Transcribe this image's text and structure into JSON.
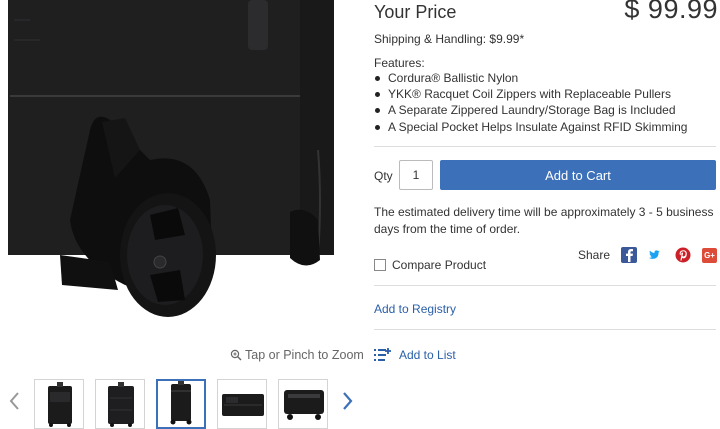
{
  "product": {
    "price_label": "Your Price",
    "price": "$ 99.99",
    "shipping": "Shipping & Handling: $9.99*",
    "features_title": "Features:",
    "features": [
      "Cordura® Ballistic Nylon",
      "YKK® Racquet Coil Zippers with Replaceable Pullers",
      "A Separate Zippered Laundry/Storage Bag is Included",
      "A Special Pocket Helps Insulate Against RFID Skimming"
    ]
  },
  "cart": {
    "qty_label": "Qty",
    "qty_value": "1",
    "add_to_cart_label": "Add to Cart"
  },
  "delivery_text": "The estimated delivery time will be approximately 3 - 5 business days from the time of order.",
  "compare_label": "Compare Product",
  "share": {
    "label": "Share",
    "networks": [
      "facebook-icon",
      "twitter-icon",
      "pinterest-icon",
      "google-plus-icon"
    ],
    "google_plus_glyph": "G+"
  },
  "registry_label": "Add to Registry",
  "list_label": "Add to List",
  "gallery": {
    "zoom_hint": "Tap or Pinch to Zoom",
    "thumbnail_count": 5,
    "active_thumbnail": 3
  },
  "colors": {
    "accent": "#3c70b8",
    "link": "#2a5fa8",
    "facebook": "#3b5998",
    "twitter": "#1da1f2",
    "pinterest": "#cb2027",
    "google_plus": "#dd4b39"
  }
}
